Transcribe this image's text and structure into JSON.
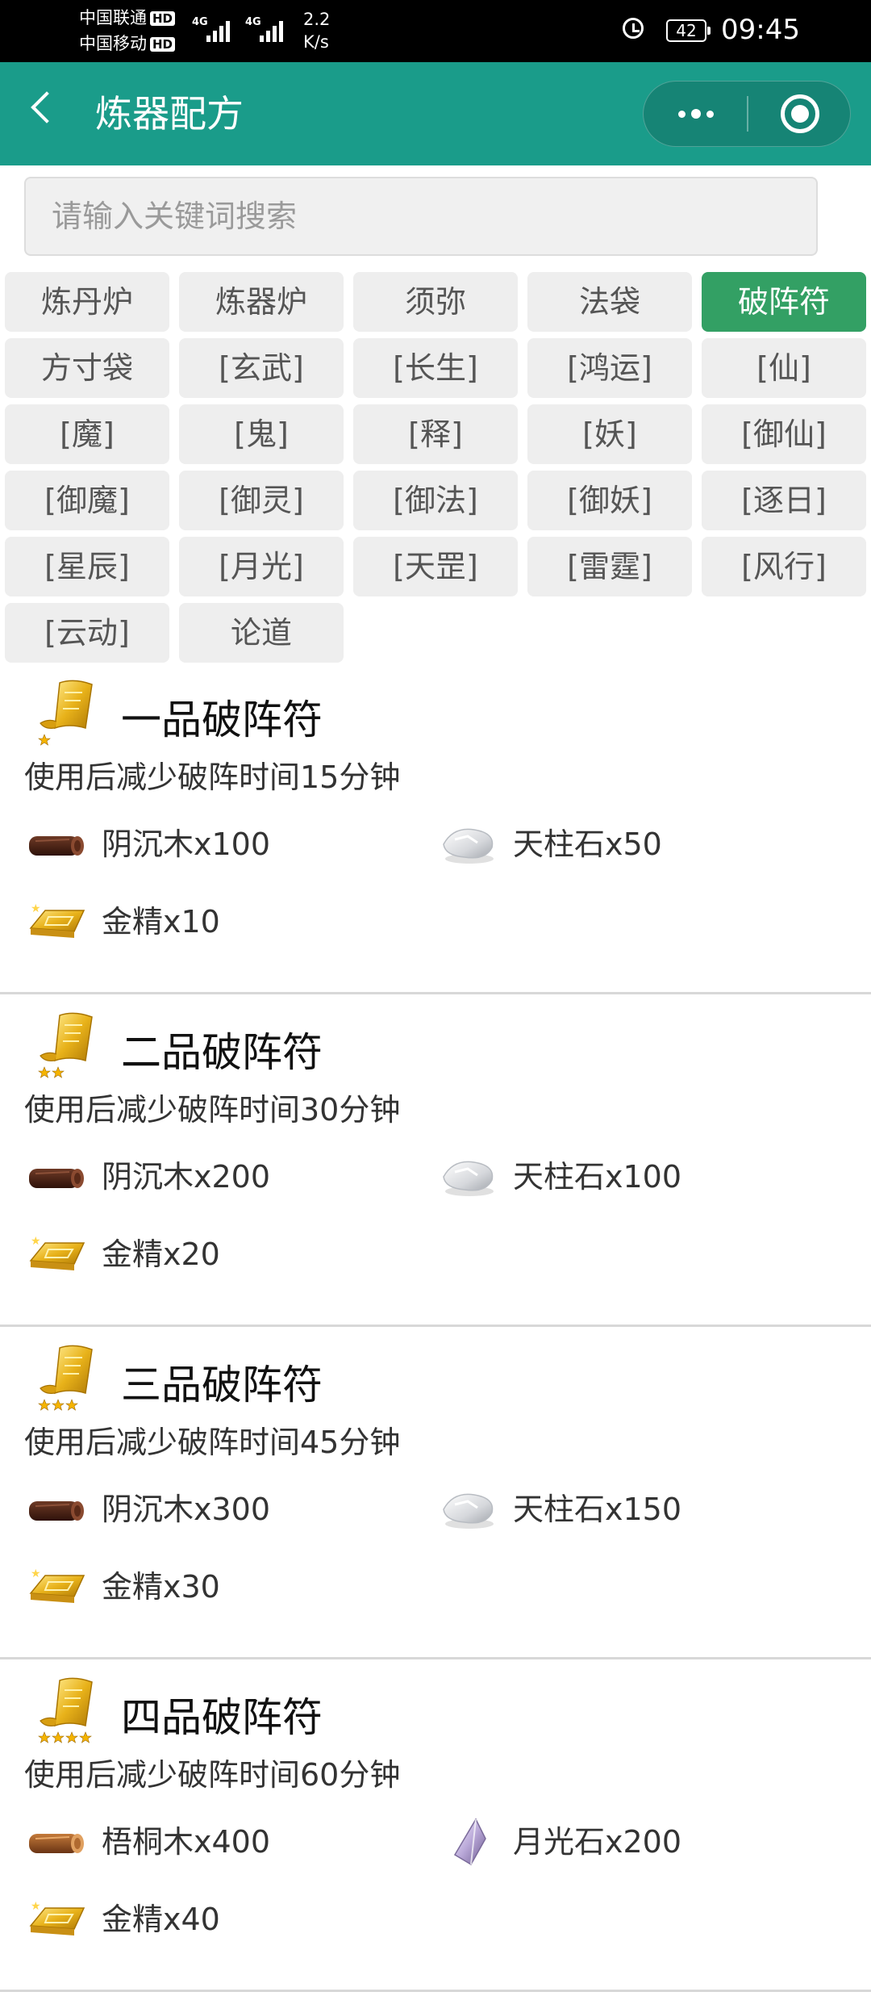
{
  "status_bar": {
    "carrier1": "中国联通",
    "carrier2": "中国移动",
    "hd_label": "HD",
    "net_type": "4G",
    "speed_value": "2.2",
    "speed_unit": "K/s",
    "battery": "42",
    "time": "09:45"
  },
  "nav": {
    "title": "炼器配方"
  },
  "search": {
    "placeholder": "请输入关键词搜索"
  },
  "categories": [
    "炼丹炉",
    "炼器炉",
    "须弥",
    "法袋",
    "破阵符",
    "方寸袋",
    "[玄武]",
    "[长生]",
    "[鸿运]",
    "[仙]",
    "[魔]",
    "[鬼]",
    "[释]",
    "[妖]",
    "[御仙]",
    "[御魔]",
    "[御灵]",
    "[御法]",
    "[御妖]",
    "[逐日]",
    "[星辰]",
    "[月光]",
    "[天罡]",
    "[雷霆]",
    "[风行]",
    "[云动]",
    "论道"
  ],
  "active_category": "破阵符",
  "recipes": [
    {
      "title": "一品破阵符",
      "stars": 1,
      "desc": "使用后减少破阵时间15分钟",
      "materials": [
        {
          "icon": "dark-wood-icon",
          "name": "阴沉木x100"
        },
        {
          "icon": "pillar-stone-icon",
          "name": "天柱石x50"
        },
        {
          "icon": "gold-ingot-icon",
          "name": "金精x10"
        }
      ]
    },
    {
      "title": "二品破阵符",
      "stars": 2,
      "desc": "使用后减少破阵时间30分钟",
      "materials": [
        {
          "icon": "dark-wood-icon",
          "name": "阴沉木x200"
        },
        {
          "icon": "pillar-stone-icon",
          "name": "天柱石x100"
        },
        {
          "icon": "gold-ingot-icon",
          "name": "金精x20"
        }
      ]
    },
    {
      "title": "三品破阵符",
      "stars": 3,
      "desc": "使用后减少破阵时间45分钟",
      "materials": [
        {
          "icon": "dark-wood-icon",
          "name": "阴沉木x300"
        },
        {
          "icon": "pillar-stone-icon",
          "name": "天柱石x150"
        },
        {
          "icon": "gold-ingot-icon",
          "name": "金精x30"
        }
      ]
    },
    {
      "title": "四品破阵符",
      "stars": 4,
      "desc": "使用后减少破阵时间60分钟",
      "materials": [
        {
          "icon": "light-wood-icon",
          "name": "梧桐木x400"
        },
        {
          "icon": "moonlight-stone-icon",
          "name": "月光石x200"
        },
        {
          "icon": "gold-ingot-icon",
          "name": "金精x40"
        }
      ]
    }
  ],
  "colors": {
    "nav_bg": "#1a9c8a",
    "active_category_bg": "#33a064",
    "category_bg": "#eeeeee"
  }
}
